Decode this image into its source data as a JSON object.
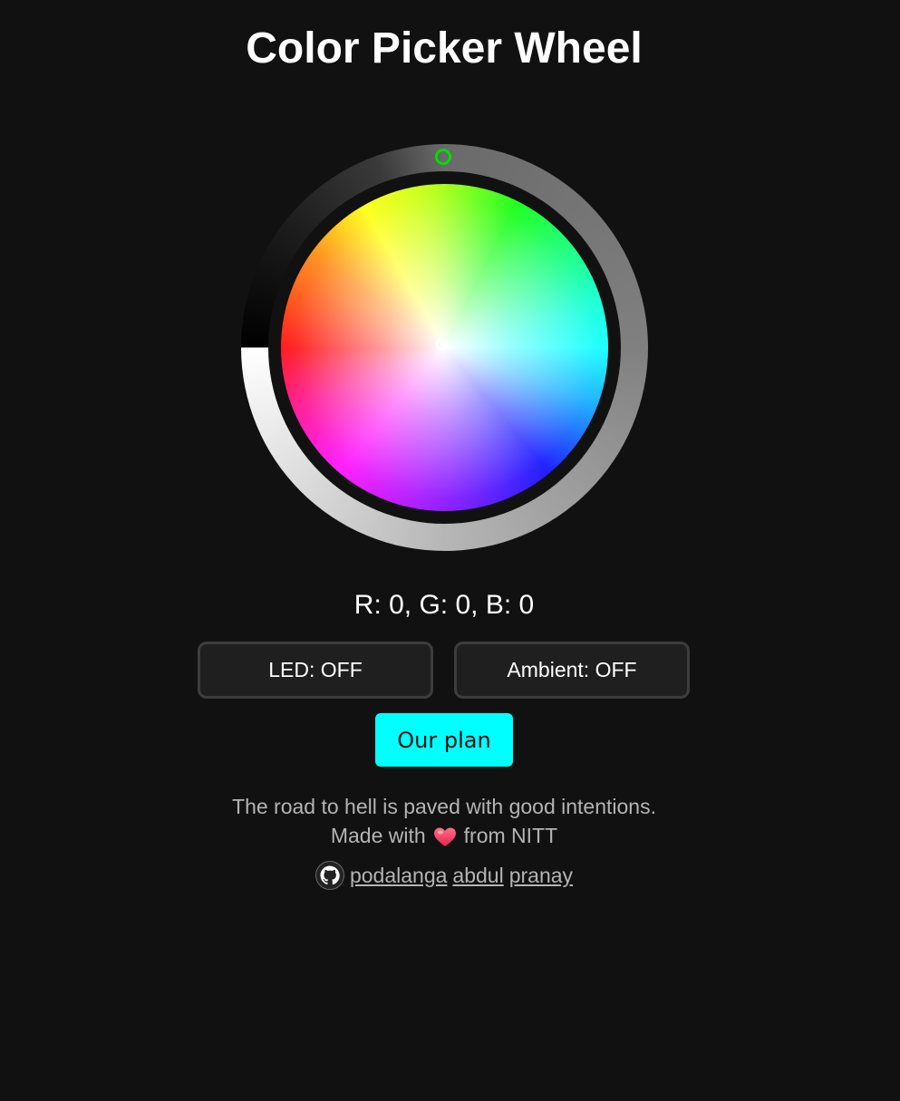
{
  "header": {
    "title": "Color Picker Wheel"
  },
  "color_wheel": {
    "selected_rgb": "R: 0, G: 0, B: 0",
    "handle_color": "#00dd00",
    "ring_icon": "brightness-ring",
    "wheel_icon": "hue-saturation-wheel"
  },
  "controls": {
    "led_label": "LED: OFF",
    "ambient_label": "Ambient: OFF",
    "plan_label": "Our plan",
    "plan_color": "#00ffff"
  },
  "footer": {
    "tagline": "The road to hell is paved with good intentions.",
    "made_with_prefix": "Made with",
    "made_with_suffix": "from NITT",
    "heart_icon": "heart-icon",
    "github_icon": "github-icon",
    "authors": [
      "podalanga",
      "abdul",
      "pranay"
    ]
  }
}
